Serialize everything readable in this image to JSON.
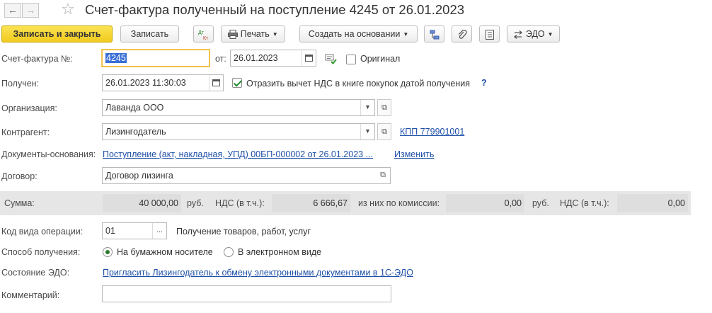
{
  "window": {
    "title": "Счет-фактура полученный на поступление 4245 от 26.01.2023"
  },
  "toolbar": {
    "save_close": "Записать и закрыть",
    "save": "Записать",
    "print": "Печать",
    "create_based": "Создать на основании",
    "edo": "ЭДО"
  },
  "form": {
    "invoice_label": "Счет-фактура №:",
    "invoice_number": "4245",
    "from_label": "от:",
    "invoice_date": "26.01.2023",
    "original_label": "Оригинал",
    "original_checked": false,
    "received_label": "Получен:",
    "received_datetime": "26.01.2023 11:30:03",
    "vat_checkbox_label": "Отразить вычет НДС в книге покупок датой получения",
    "vat_checkbox_checked": true,
    "help": "?",
    "org_label": "Организация:",
    "org_value": "Лаванда ООО",
    "contractor_label": "Контрагент:",
    "contractor_value": "Лизингодатель",
    "kpp_link": "КПП 779901001",
    "docs_label": "Документы-основания:",
    "docs_link": "Поступление (акт, накладная, УПД) 00БП-000002 от 26.01.2023 ...",
    "change_link": "Изменить",
    "contract_label": "Договор:",
    "contract_value": "Договор лизинга"
  },
  "sums": {
    "sum_label": "Сумма:",
    "sum_value": "40 000,00",
    "currency": "руб.",
    "vat_label": "НДС (в т.ч.):",
    "vat_value": "6 666,67",
    "commission_label": "из них по комиссии:",
    "commission_value": "0,00",
    "commission_currency": "руб.",
    "vat2_label": "НДС (в т.ч.):",
    "vat2_value": "0,00"
  },
  "bottom": {
    "op_code_label": "Код вида операции:",
    "op_code_value": "01",
    "op_code_desc": "Получение товаров, работ, услуг",
    "receive_method_label": "Способ получения:",
    "receive_paper": "На бумажном носителе",
    "receive_electronic": "В электронном виде",
    "receive_selected": "paper",
    "edo_state_label": "Состояние ЭДО:",
    "edo_state_link": "Пригласить Лизингодатель к обмену электронными документами в 1С-ЭДО",
    "comment_label": "Комментарий:",
    "comment_value": ""
  },
  "colors": {
    "primary_button": "#f1cb1e",
    "link": "#1d4fa8",
    "focus_border": "#f0b83a",
    "selection": "#3b6fd6"
  }
}
